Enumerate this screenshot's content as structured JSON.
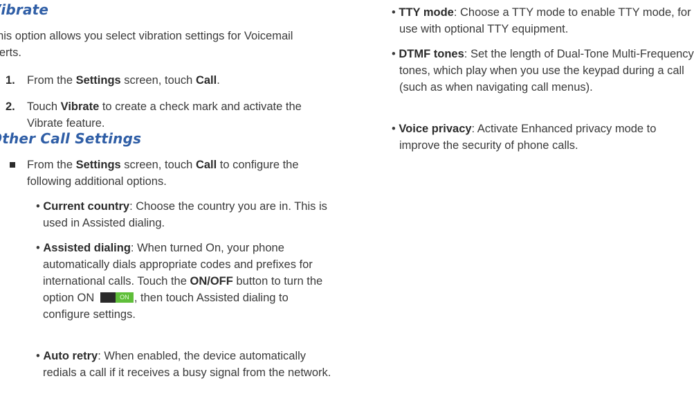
{
  "left": {
    "section1": {
      "heading": "Vibrate",
      "intro": "This option allows you select vibration settings for Voicemail alerts.",
      "steps": [
        {
          "num": "1.",
          "pre": "From the ",
          "b1": "Settings",
          "mid": " screen, touch ",
          "b2": "Call",
          "post": "."
        },
        {
          "num": "2.",
          "pre": "Touch ",
          "b1": "Vibrate",
          "post": " to create a check mark and activate the Vibrate feature."
        }
      ]
    },
    "section2": {
      "heading": "Other Call Settings",
      "lead": {
        "pre": "From the ",
        "b1": "Settings",
        "mid": " screen, touch ",
        "b2": "Call",
        "post": " to configure the following additional options."
      },
      "bullets": [
        {
          "term": "Current country",
          "text": ": Choose the country you are in. This is used in Assisted dialing."
        },
        {
          "term": "Assisted dialing",
          "text": ": When turned On, your phone automatically dials appropriate codes and prefixes for international calls. Touch the ",
          "b2": "ON/OFF",
          "text2": " button to turn the option ON ",
          "toggle_label": "ON",
          "text3": ", then touch Assisted dialing to configure settings."
        },
        {
          "term": "Auto retry",
          "text": ": When enabled, the device automatically redials a call if it receives a busy signal from the network."
        }
      ]
    }
  },
  "right": {
    "bullets": [
      {
        "term": "TTY mode",
        "text": ": Choose a TTY mode to enable TTY mode, for use with optional TTY equipment."
      },
      {
        "term": "DTMF tones",
        "text": ": Set the length of Dual-Tone Multi-Frequency tones, which play when you use the keypad during a call (such as when navigating call menus)."
      },
      {
        "term": "Voice privacy",
        "text": ": Activate Enhanced privacy mode to improve the security of phone calls."
      }
    ]
  },
  "colors": {
    "heading": "#2f5ea6",
    "toggle_on": "#5fbe3a",
    "toggle_off": "#2a2a2a"
  }
}
